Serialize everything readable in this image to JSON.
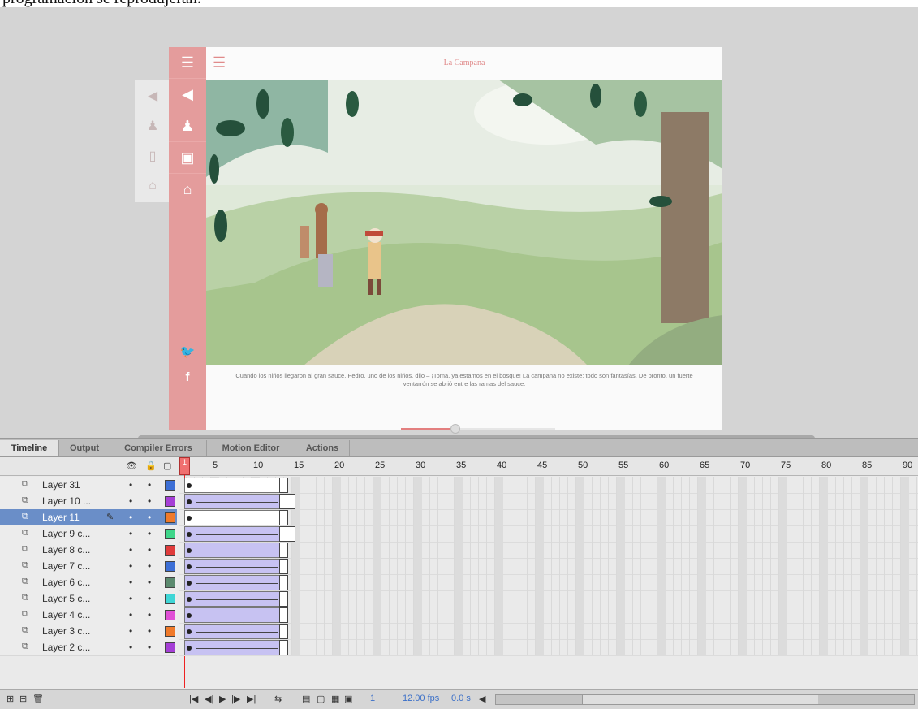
{
  "caption": "programación se reprodujeran.",
  "app": {
    "title": "La Campana",
    "story_text": "Cuando los niños llegaron al gran sauce, Pedro, uno de los niños, dijo – ¡Toma, ya estamos en el bosque! La campana no existe; todo son fantasías. De pronto, un fuerte ventarrón se abrió entre las ramas del sauce.",
    "progress": 0.45,
    "sidebar_icons": [
      "menu-icon",
      "sound-icon",
      "person-icon",
      "bookmark-icon",
      "home-icon"
    ],
    "social_icons": [
      "twitter-icon",
      "facebook-icon"
    ]
  },
  "timeline": {
    "tabs": [
      "Timeline",
      "Output",
      "Compiler Errors",
      "Motion Editor",
      "Actions"
    ],
    "active_tab": "Timeline",
    "current_frame": "1",
    "frame_numbers": [
      "5",
      "10",
      "15",
      "20",
      "25",
      "30",
      "35",
      "40",
      "45",
      "50",
      "55",
      "60",
      "65",
      "70",
      "75",
      "80",
      "85",
      "90"
    ],
    "layers": [
      {
        "name": "Layer 31",
        "color": "#3d6fd6",
        "tween": "plain",
        "selected": false
      },
      {
        "name": "Layer 10 ...",
        "color": "#a53fd6",
        "tween": "motion",
        "selected": false
      },
      {
        "name": "Layer 11",
        "color": "#f07a2a",
        "tween": "plain",
        "selected": true
      },
      {
        "name": "Layer 9 c...",
        "color": "#3fd68a",
        "tween": "motion",
        "selected": false
      },
      {
        "name": "Layer 8 c...",
        "color": "#e03c3c",
        "tween": "motion",
        "selected": false
      },
      {
        "name": "Layer 7 c...",
        "color": "#3d6fd6",
        "tween": "motion",
        "selected": false
      },
      {
        "name": "Layer 6 c...",
        "color": "#5b8a6e",
        "tween": "motion",
        "selected": false
      },
      {
        "name": "Layer 5 c...",
        "color": "#3fd6d6",
        "tween": "motion",
        "selected": false
      },
      {
        "name": "Layer 4 c...",
        "color": "#e04fd6",
        "tween": "motion",
        "selected": false
      },
      {
        "name": "Layer 3 c...",
        "color": "#f07a2a",
        "tween": "motion",
        "selected": false
      },
      {
        "name": "Layer 2 c...",
        "color": "#a53fd6",
        "tween": "motion",
        "selected": false
      }
    ],
    "footer": {
      "frame": "1",
      "fps": "12.00 fps",
      "time": "0.0 s"
    }
  }
}
